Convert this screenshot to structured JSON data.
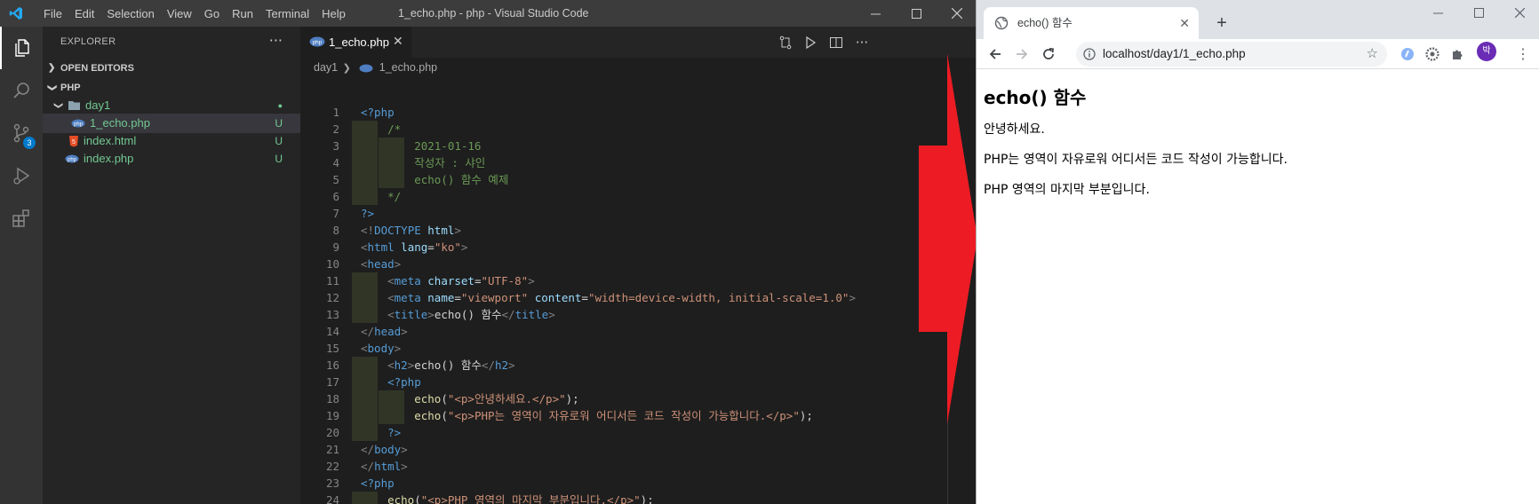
{
  "vscode": {
    "menu": [
      "File",
      "Edit",
      "Selection",
      "View",
      "Go",
      "Run",
      "Terminal",
      "Help"
    ],
    "window_title": "1_echo.php - php - Visual Studio Code",
    "activity_badge": "3",
    "explorer": {
      "header": "EXPLORER",
      "open_editors": "OPEN EDITORS",
      "workspace": "PHP",
      "tree": [
        {
          "label": "day1",
          "type": "folder",
          "decoration": "●",
          "color": "#73c991"
        },
        {
          "label": "1_echo.php",
          "type": "php",
          "decoration": "U",
          "color": "#73c991"
        },
        {
          "label": "index.html",
          "type": "html",
          "decoration": "U",
          "color": "#73c991"
        },
        {
          "label": "index.php",
          "type": "php",
          "decoration": "U",
          "color": "#73c991"
        }
      ]
    },
    "tab": {
      "label": "1_echo.php",
      "close": "✕"
    },
    "breadcrumb": {
      "folder": "day1",
      "file": "1_echo.php"
    },
    "code_lines": [
      [
        [
          "k-tag",
          "<?php"
        ]
      ],
      [
        [
          "k-cmt",
          "    /*"
        ]
      ],
      [
        [
          "k-cmt",
          "        2021-01-16"
        ]
      ],
      [
        [
          "k-cmt",
          "        작성자 : 샤인"
        ]
      ],
      [
        [
          "k-cmt",
          "        echo() 함수 예제"
        ]
      ],
      [
        [
          "k-cmt",
          "    */"
        ]
      ],
      [
        [
          "k-tag",
          "?>"
        ]
      ],
      [
        [
          "k-punc",
          "<!"
        ],
        [
          "k-tag",
          "DOCTYPE"
        ],
        [
          "k-txt",
          " "
        ],
        [
          "k-attr",
          "html"
        ],
        [
          "k-punc",
          ">"
        ]
      ],
      [
        [
          "k-punc",
          "<"
        ],
        [
          "k-tag",
          "html"
        ],
        [
          "k-txt",
          " "
        ],
        [
          "k-attr",
          "lang"
        ],
        [
          "k-txt",
          "="
        ],
        [
          "k-str",
          "\"ko\""
        ],
        [
          "k-punc",
          ">"
        ]
      ],
      [
        [
          "k-punc",
          "<"
        ],
        [
          "k-tag",
          "head"
        ],
        [
          "k-punc",
          ">"
        ]
      ],
      [
        [
          "k-txt",
          "    "
        ],
        [
          "k-punc",
          "<"
        ],
        [
          "k-tag",
          "meta"
        ],
        [
          "k-txt",
          " "
        ],
        [
          "k-attr",
          "charset"
        ],
        [
          "k-txt",
          "="
        ],
        [
          "k-str",
          "\"UTF-8\""
        ],
        [
          "k-punc",
          ">"
        ]
      ],
      [
        [
          "k-txt",
          "    "
        ],
        [
          "k-punc",
          "<"
        ],
        [
          "k-tag",
          "meta"
        ],
        [
          "k-txt",
          " "
        ],
        [
          "k-attr",
          "name"
        ],
        [
          "k-txt",
          "="
        ],
        [
          "k-str",
          "\"viewport\""
        ],
        [
          "k-txt",
          " "
        ],
        [
          "k-attr",
          "content"
        ],
        [
          "k-txt",
          "="
        ],
        [
          "k-str",
          "\"width=device-width, initial-scale=1.0\""
        ],
        [
          "k-punc",
          ">"
        ]
      ],
      [
        [
          "k-txt",
          "    "
        ],
        [
          "k-punc",
          "<"
        ],
        [
          "k-tag",
          "title"
        ],
        [
          "k-punc",
          ">"
        ],
        [
          "k-txt",
          "echo() 함수"
        ],
        [
          "k-punc",
          "</"
        ],
        [
          "k-tag",
          "title"
        ],
        [
          "k-punc",
          ">"
        ]
      ],
      [
        [
          "k-punc",
          "</"
        ],
        [
          "k-tag",
          "head"
        ],
        [
          "k-punc",
          ">"
        ]
      ],
      [
        [
          "k-punc",
          "<"
        ],
        [
          "k-tag",
          "body"
        ],
        [
          "k-punc",
          ">"
        ]
      ],
      [
        [
          "k-txt",
          "    "
        ],
        [
          "k-punc",
          "<"
        ],
        [
          "k-tag",
          "h2"
        ],
        [
          "k-punc",
          ">"
        ],
        [
          "k-txt",
          "echo() 함수"
        ],
        [
          "k-punc",
          "</"
        ],
        [
          "k-tag",
          "h2"
        ],
        [
          "k-punc",
          ">"
        ]
      ],
      [
        [
          "k-txt",
          "    "
        ],
        [
          "k-tag",
          "<?php"
        ]
      ],
      [
        [
          "k-txt",
          "        "
        ],
        [
          "k-fn",
          "echo"
        ],
        [
          "k-txt",
          "("
        ],
        [
          "k-str",
          "\"<p>안녕하세요.</p>\""
        ],
        [
          "k-txt",
          ");"
        ]
      ],
      [
        [
          "k-txt",
          "        "
        ],
        [
          "k-fn",
          "echo"
        ],
        [
          "k-txt",
          "("
        ],
        [
          "k-str",
          "\"<p>PHP는 영역이 자유로워 어디서든 코드 작성이 가능합니다.</p>\""
        ],
        [
          "k-txt",
          ");"
        ]
      ],
      [
        [
          "k-txt",
          "    "
        ],
        [
          "k-tag",
          "?>"
        ]
      ],
      [
        [
          "k-punc",
          "</"
        ],
        [
          "k-tag",
          "body"
        ],
        [
          "k-punc",
          ">"
        ]
      ],
      [
        [
          "k-punc",
          "</"
        ],
        [
          "k-tag",
          "html"
        ],
        [
          "k-punc",
          ">"
        ]
      ],
      [
        [
          "k-tag",
          "<?php"
        ]
      ],
      [
        [
          "k-txt",
          "    "
        ],
        [
          "k-fn",
          "echo"
        ],
        [
          "k-txt",
          "("
        ],
        [
          "k-str",
          "\"<p>PHP 영역의 마지막 부분입니다.</p>\""
        ],
        [
          "k-txt",
          ");"
        ]
      ],
      [
        [
          "k-tag",
          "?>"
        ]
      ]
    ],
    "current_line": 25
  },
  "browser": {
    "tab_title": "echo() 함수",
    "tab_close": "✕",
    "new_tab": "+",
    "url": "localhost/day1/1_echo.php",
    "profile_initial": "박",
    "page": {
      "heading": "echo() 함수",
      "paragraphs": [
        "안녕하세요.",
        "PHP는 영역이 자유로워 어디서든 코드 작성이 가능합니다.",
        "PHP 영역의 마지막 부분입니다."
      ]
    }
  },
  "colors": {
    "arrow": "#ed1c24",
    "vscode_accent": "#007acc",
    "git_untracked": "#73c991"
  }
}
